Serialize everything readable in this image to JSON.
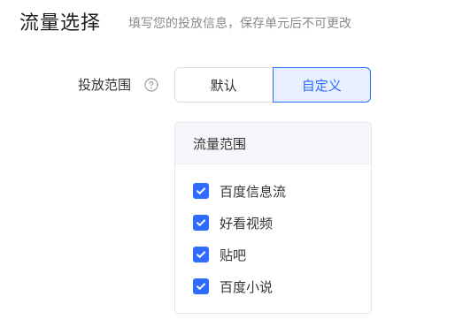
{
  "section": {
    "title": "流量选择",
    "hint": "填写您的投放信息，保存单元后不可更改"
  },
  "placement": {
    "label": "投放范围",
    "help_icon": "question-circle-icon",
    "options": [
      "默认",
      "自定义"
    ],
    "selected": "自定义"
  },
  "traffic_panel": {
    "header": "流量范围",
    "items": [
      {
        "label": "百度信息流",
        "checked": true
      },
      {
        "label": "好看视频",
        "checked": true
      },
      {
        "label": "贴吧",
        "checked": true
      },
      {
        "label": "百度小说",
        "checked": true
      }
    ]
  },
  "colors": {
    "accent": "#2f6bff",
    "accent_bg": "#e8f0ff",
    "hint_text": "#8a8a8a"
  }
}
